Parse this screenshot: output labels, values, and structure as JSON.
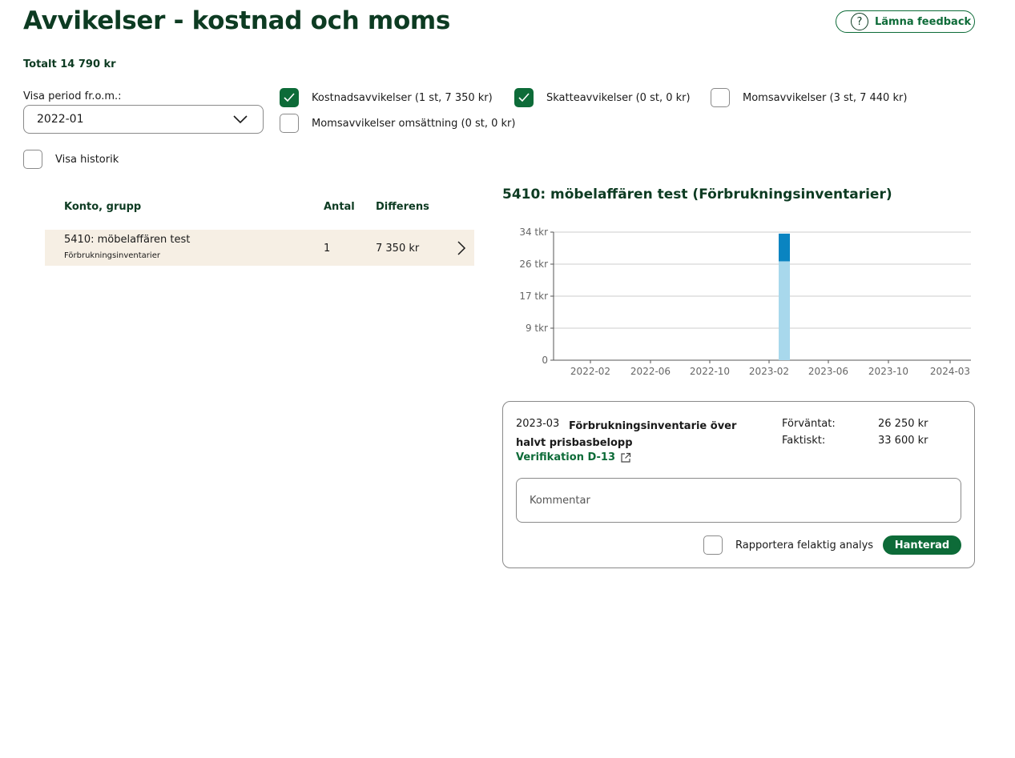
{
  "page": {
    "title": "Avvikelser - kostnad och moms",
    "feedback_label": "Lämna feedback",
    "total": "Totalt 14 790 kr"
  },
  "filters": {
    "period_label": "Visa period fr.o.m.:",
    "period_value": "2022-01",
    "checkboxes": [
      {
        "label": "Kostnadsavvikelser (1 st, 7 350 kr)",
        "checked": true
      },
      {
        "label": "Skatteavvikelser (0 st, 0 kr)",
        "checked": true
      },
      {
        "label": "Momsavvikelser (3 st, 7 440 kr)",
        "checked": false
      },
      {
        "label": "Momsavvikelser omsättning (0 st, 0 kr)",
        "checked": false
      }
    ],
    "history_label": "Visa historik",
    "history_checked": false
  },
  "table": {
    "headers": {
      "account": "Konto, grupp",
      "count": "Antal",
      "diff": "Differens"
    },
    "rows": [
      {
        "name": "5410: möbelaffären test",
        "group": "Förbrukningsinventarier",
        "count": "1",
        "diff": "7 350 kr"
      }
    ]
  },
  "chart_title": "5410: möbelaffären test (Förbrukningsinventarier)",
  "chart_data": {
    "type": "bar",
    "stacked": true,
    "y_ticks": [
      "0",
      "9 tkr",
      "17 tkr",
      "26 tkr",
      "34 tkr"
    ],
    "x_ticks": [
      "2022-02",
      "2022-06",
      "2022-10",
      "2023-02",
      "2023-06",
      "2023-10",
      "2024-03"
    ],
    "ylim": [
      0,
      34
    ],
    "bars": [
      {
        "x": "2023-03",
        "expected": 26.25,
        "actual": 33.6
      }
    ],
    "colors": {
      "expected": "#a8d8ec",
      "excess": "#0a84c1",
      "grid": "#cccccc",
      "axis": "#555555"
    }
  },
  "detail": {
    "period": "2023-03",
    "description": "Förbrukningsinventarie över halvt prisbasbelopp",
    "verification": "Verifikation D-13",
    "expected_label": "Förväntat:",
    "expected_value": "26 250 kr",
    "actual_label": "Faktiskt:",
    "actual_value": "33 600 kr",
    "comment_placeholder": "Kommentar",
    "report_label": "Rapportera felaktig analys",
    "handled_label": "Hanterad"
  },
  "colors": {
    "brand": "#0d6b38",
    "title": "#0d3b22",
    "row_highlight": "#f6efe4"
  }
}
